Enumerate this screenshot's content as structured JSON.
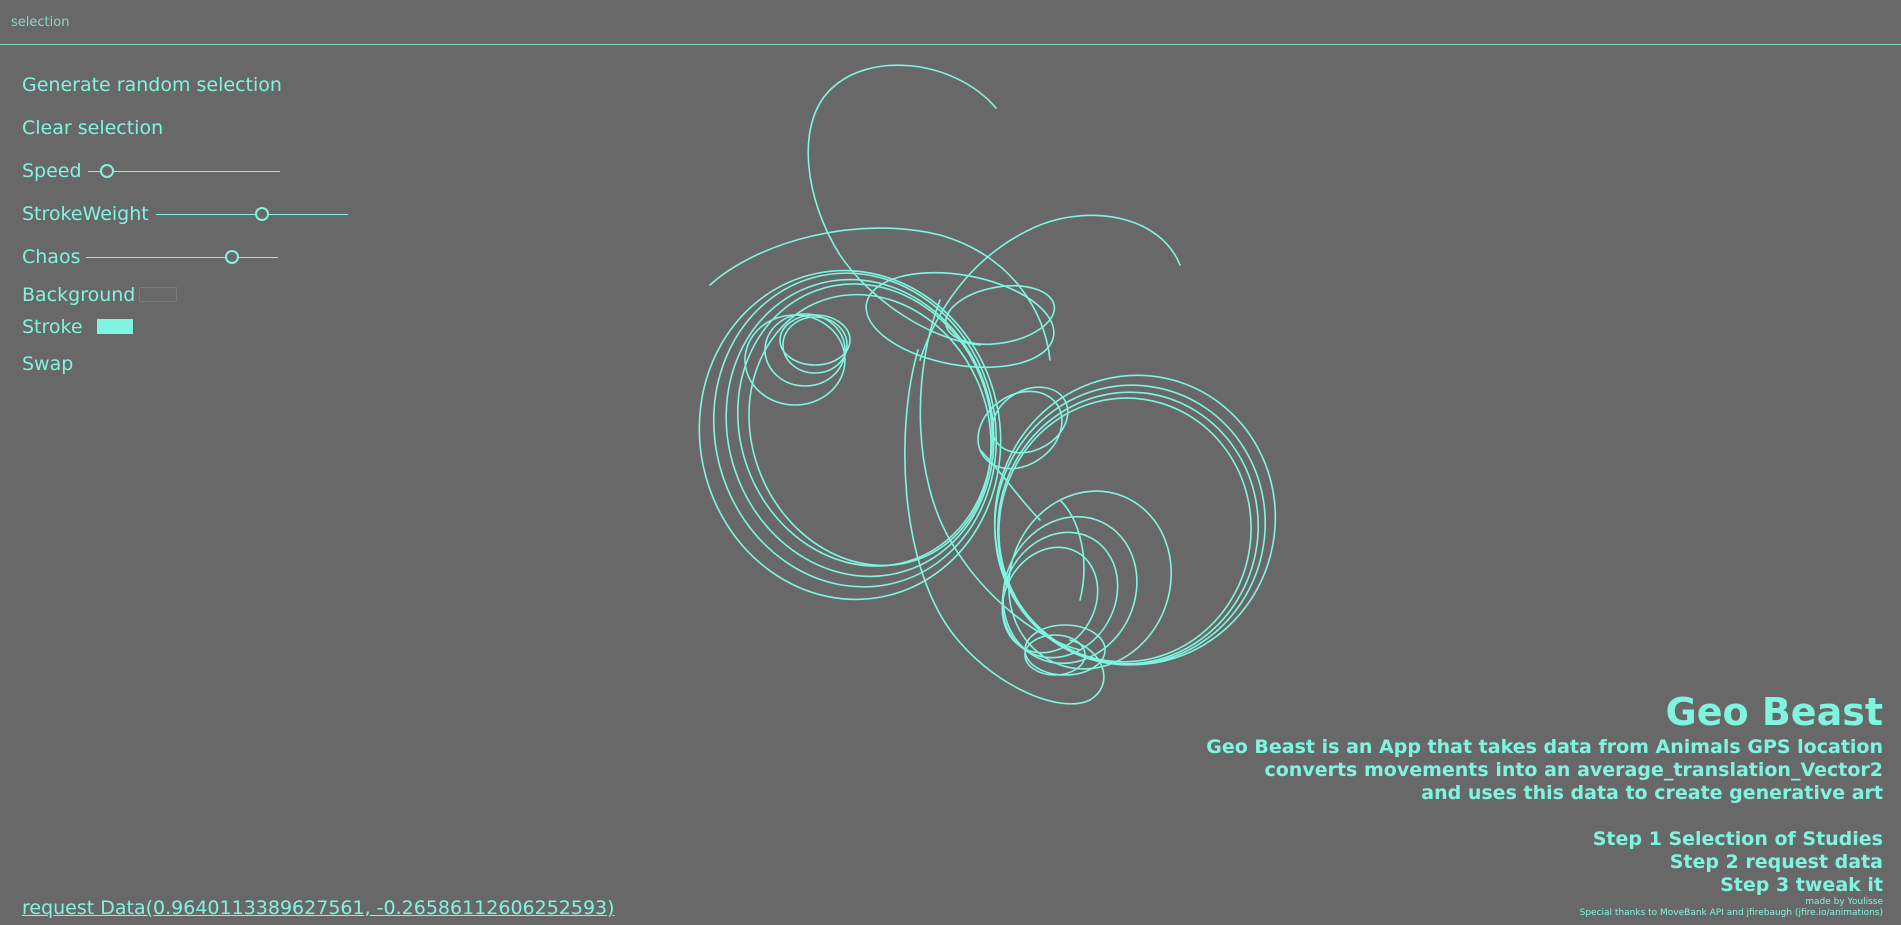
{
  "topbar": {
    "title": "selection"
  },
  "controls": {
    "generate_label": "Generate random selection",
    "clear_label": "Clear selection",
    "speed": {
      "label": "Speed",
      "value": 0.1
    },
    "stroke_weight": {
      "label": "StrokeWeight",
      "value": 0.55
    },
    "chaos": {
      "label": "Chaos",
      "value": 0.76
    },
    "background": {
      "label": "Background",
      "color": "#686868"
    },
    "stroke": {
      "label": "Stroke",
      "color": "#7ff5e0"
    },
    "swap_label": "Swap"
  },
  "info": {
    "title": "Geo Beast",
    "lines": [
      "Geo Beast is an App that takes data from Animals GPS location",
      "converts movements into an average_translation_Vector2",
      "and uses this data to create generative art"
    ],
    "steps": [
      "Step 1 Selection of Studies",
      "Step 2 request data",
      "Step 3 tweak it"
    ],
    "credit_1": "made by Youlisse",
    "credit_2": "Special thanks to MoveBank API and jfirebaugh (jfire.io/animations)"
  },
  "request_link": "request Data(0.9640113389627561, -0.26586112606252593)",
  "colors": {
    "background": "#686868",
    "accent": "#7ff5e0"
  }
}
